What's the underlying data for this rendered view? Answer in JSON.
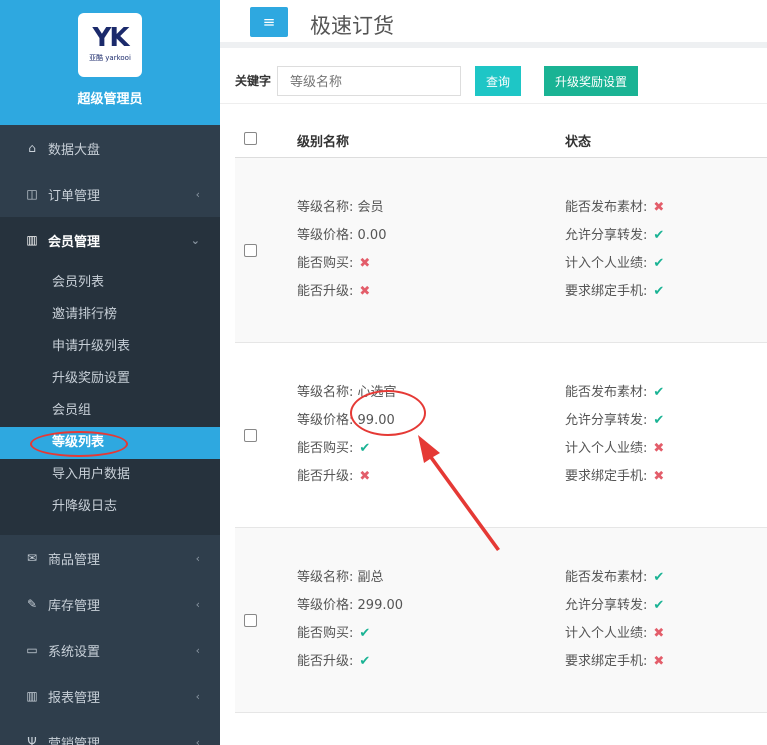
{
  "brand": {
    "logo_text": "YK",
    "logo_sub": "亚酷 yarkooi",
    "role": "超级管理员"
  },
  "sidebar": {
    "items": [
      {
        "label": "数据大盘",
        "icon": "home-icon"
      },
      {
        "label": "订单管理",
        "icon": "columns-icon"
      },
      {
        "label": "会员管理",
        "icon": "bar-chart-icon"
      }
    ],
    "submenu": [
      {
        "label": "会员列表"
      },
      {
        "label": "邀请排行榜"
      },
      {
        "label": "申请升级列表"
      },
      {
        "label": "升级奖励设置"
      },
      {
        "label": "会员组"
      },
      {
        "label": "等级列表"
      },
      {
        "label": "导入用户数据"
      },
      {
        "label": "升降级日志"
      }
    ],
    "items_after": [
      {
        "label": "商品管理",
        "icon": "envelope-icon"
      },
      {
        "label": "库存管理",
        "icon": "edit-icon"
      },
      {
        "label": "系统设置",
        "icon": "monitor-icon"
      },
      {
        "label": "报表管理",
        "icon": "bar-chart-icon"
      },
      {
        "label": "营销管理",
        "icon": "utensils-icon"
      }
    ]
  },
  "header": {
    "title": "极速订货",
    "menu_icon": "≡"
  },
  "filter": {
    "keyword_label": "关键字",
    "keyword_placeholder": "等级名称",
    "search_label": "查询",
    "reward_label": "升级奖励设置"
  },
  "table": {
    "headers": {
      "name": "级别名称",
      "status": "状态"
    },
    "labels": {
      "name": "等级名称:",
      "price": "等级价格:",
      "buy": "能否购买:",
      "upgrade": "能否升级:",
      "publish": "能否发布素材:",
      "share": "允许分享转发:",
      "perf": "计入个人业绩:",
      "bind": "要求绑定手机:"
    },
    "rows": [
      {
        "name": "会员",
        "price": "0.00",
        "buy": "✖",
        "upgrade": "✖",
        "publish": "✖",
        "share": "✔",
        "perf": "✔",
        "bind": "✔"
      },
      {
        "name": "心选官",
        "price": "99.00",
        "buy": "✔",
        "upgrade": "✖",
        "publish": "✔",
        "share": "✔",
        "perf": "✖",
        "bind": "✖"
      },
      {
        "name": "副总",
        "price": "299.00",
        "buy": "✔",
        "upgrade": "✔",
        "publish": "✔",
        "share": "✔",
        "perf": "✖",
        "bind": "✖"
      }
    ]
  },
  "colors": {
    "accent": "#2ea8e0",
    "sidebar_bg": "#2f3e4c",
    "yes": "#1ab394",
    "no": "#e35d6a",
    "annotation": "#e53935"
  }
}
